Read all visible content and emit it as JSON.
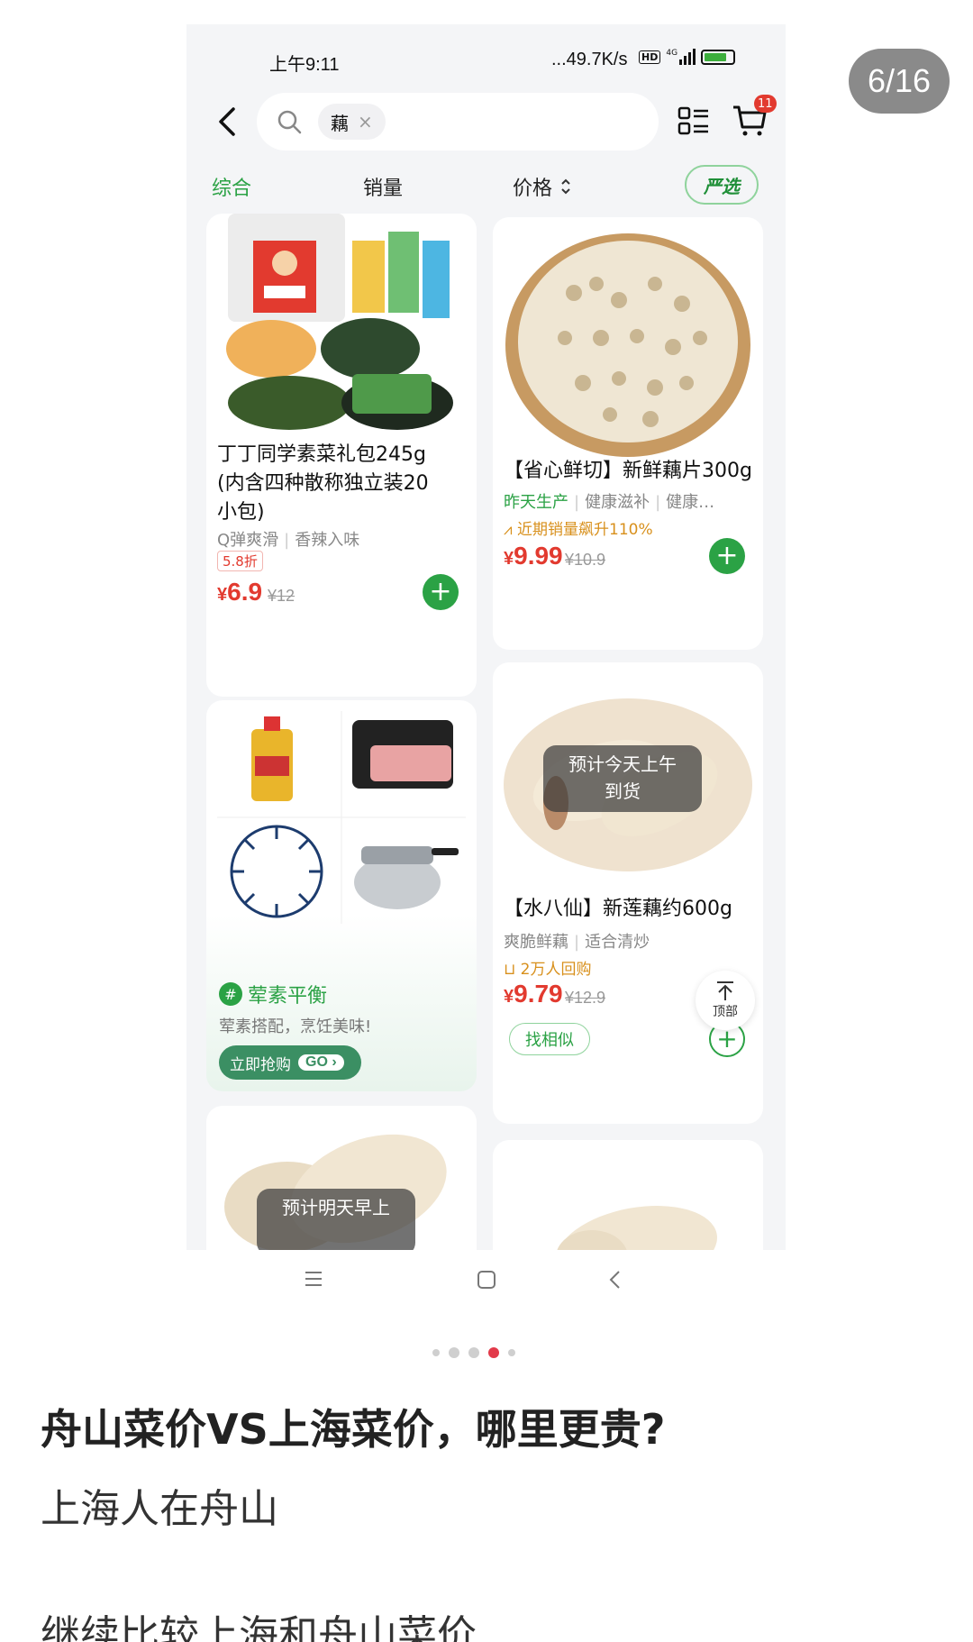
{
  "viewer": {
    "page_counter": "6/16"
  },
  "status_bar": {
    "time": "上午9:11",
    "network_speed": "...49.7K/s",
    "hd_label": "HD",
    "signal_label": "4G"
  },
  "search": {
    "chip_text": "藕",
    "chip_clear": "×"
  },
  "cart": {
    "badge_count": "11"
  },
  "tabs": {
    "comprehensive": "综合",
    "sales": "销量",
    "price": "价格",
    "yanxuan": "严选"
  },
  "products": [
    {
      "title_lines": [
        "丁丁同学素菜礼包245g",
        "(内含四种散称独立装20",
        "小包)"
      ],
      "tags": [
        "Q弹爽滑",
        "香辣入味"
      ],
      "discount": "5.8折",
      "price_symbol": "¥",
      "price": "6.9",
      "original_price": "¥12"
    },
    {
      "title": "【省心鲜切】新鲜藕片300g",
      "tag_highlight": "昨天生产",
      "tags": [
        "健康滋补",
        "健康…"
      ],
      "trend": "近期销量飙升110%",
      "price_symbol": "¥",
      "price": "9.99",
      "original_price": "¥10.9"
    },
    {
      "overlay_lines": [
        "预计今天上午",
        "到货"
      ],
      "title": "【水八仙】新莲藕约600g",
      "tags": [
        "爽脆鲜藕",
        "适合清炒"
      ],
      "repurchase": "2万人回购",
      "price_symbol": "¥",
      "price": "9.79",
      "original_price": "¥12.9",
      "similar_label": "找相似"
    },
    {
      "overlay_lines": [
        "预计明天早上"
      ]
    }
  ],
  "promo": {
    "title": "荤素平衡",
    "subtitle": "荤素搭配，烹饪美味!",
    "button_label": "立即抢购",
    "go_label": "GO ›",
    "hash": "#"
  },
  "back_to_top": {
    "label": "顶部"
  },
  "post": {
    "title": "舟山菜价VS上海菜价，哪里更贵?",
    "author": "上海人在舟山",
    "body_first_line": "继续比较上海和舟山菜价"
  },
  "colors": {
    "accent_green": "#2ba245",
    "price_red": "#e23a2f",
    "active_dot": "#e23a4a"
  },
  "carousel": {
    "total_dots": 5,
    "active_index": 3
  }
}
